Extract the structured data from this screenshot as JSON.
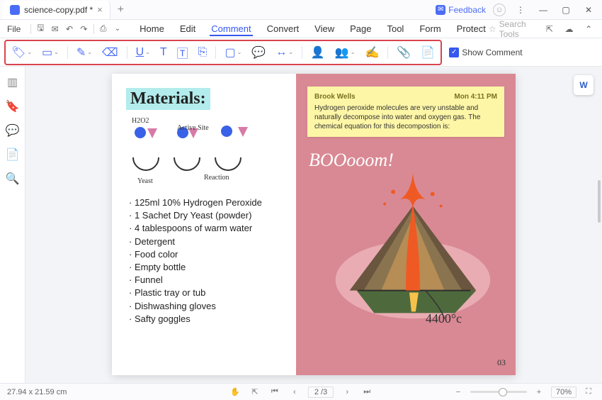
{
  "tb": {
    "tab": "science-copy.pdf *",
    "feedback": "Feedback"
  },
  "qab": {
    "file": "File"
  },
  "menu": {
    "home": "Home",
    "edit": "Edit",
    "comment": "Comment",
    "convert": "Convert",
    "view": "View",
    "page": "Page",
    "tool": "Tool",
    "form": "Form",
    "protect": "Protect"
  },
  "search_ph": "Search Tools",
  "show_comment": "Show Comment",
  "left_page": {
    "heading": "Materials:",
    "sk": {
      "h2o2": "H2O2",
      "active": "Active Site",
      "yeast": "Yeast",
      "reaction": "Reaction"
    },
    "materials": [
      "125ml 10% Hydrogen Peroxide",
      "1 Sachet Dry Yeast (powder)",
      "4 tablespoons of warm water",
      "Detergent",
      "Food color",
      "Empty bottle",
      "Funnel",
      "Plastic tray or tub",
      "Dishwashing gloves",
      "Safty goggles"
    ]
  },
  "note": {
    "author": "Brook Wells",
    "time": "Mon 4:11 PM",
    "body": "Hydrogen peroxide molecules are very unstable and naturally decompose into water and oxygen gas. The chemical equation for this decompostion is:"
  },
  "right_page": {
    "boom": "BOOooom!",
    "temp": "4400°c",
    "pagenum": "03"
  },
  "status": {
    "dim": "27.94 x 21.59 cm",
    "pages": "2 /3",
    "zoom": "70%"
  }
}
